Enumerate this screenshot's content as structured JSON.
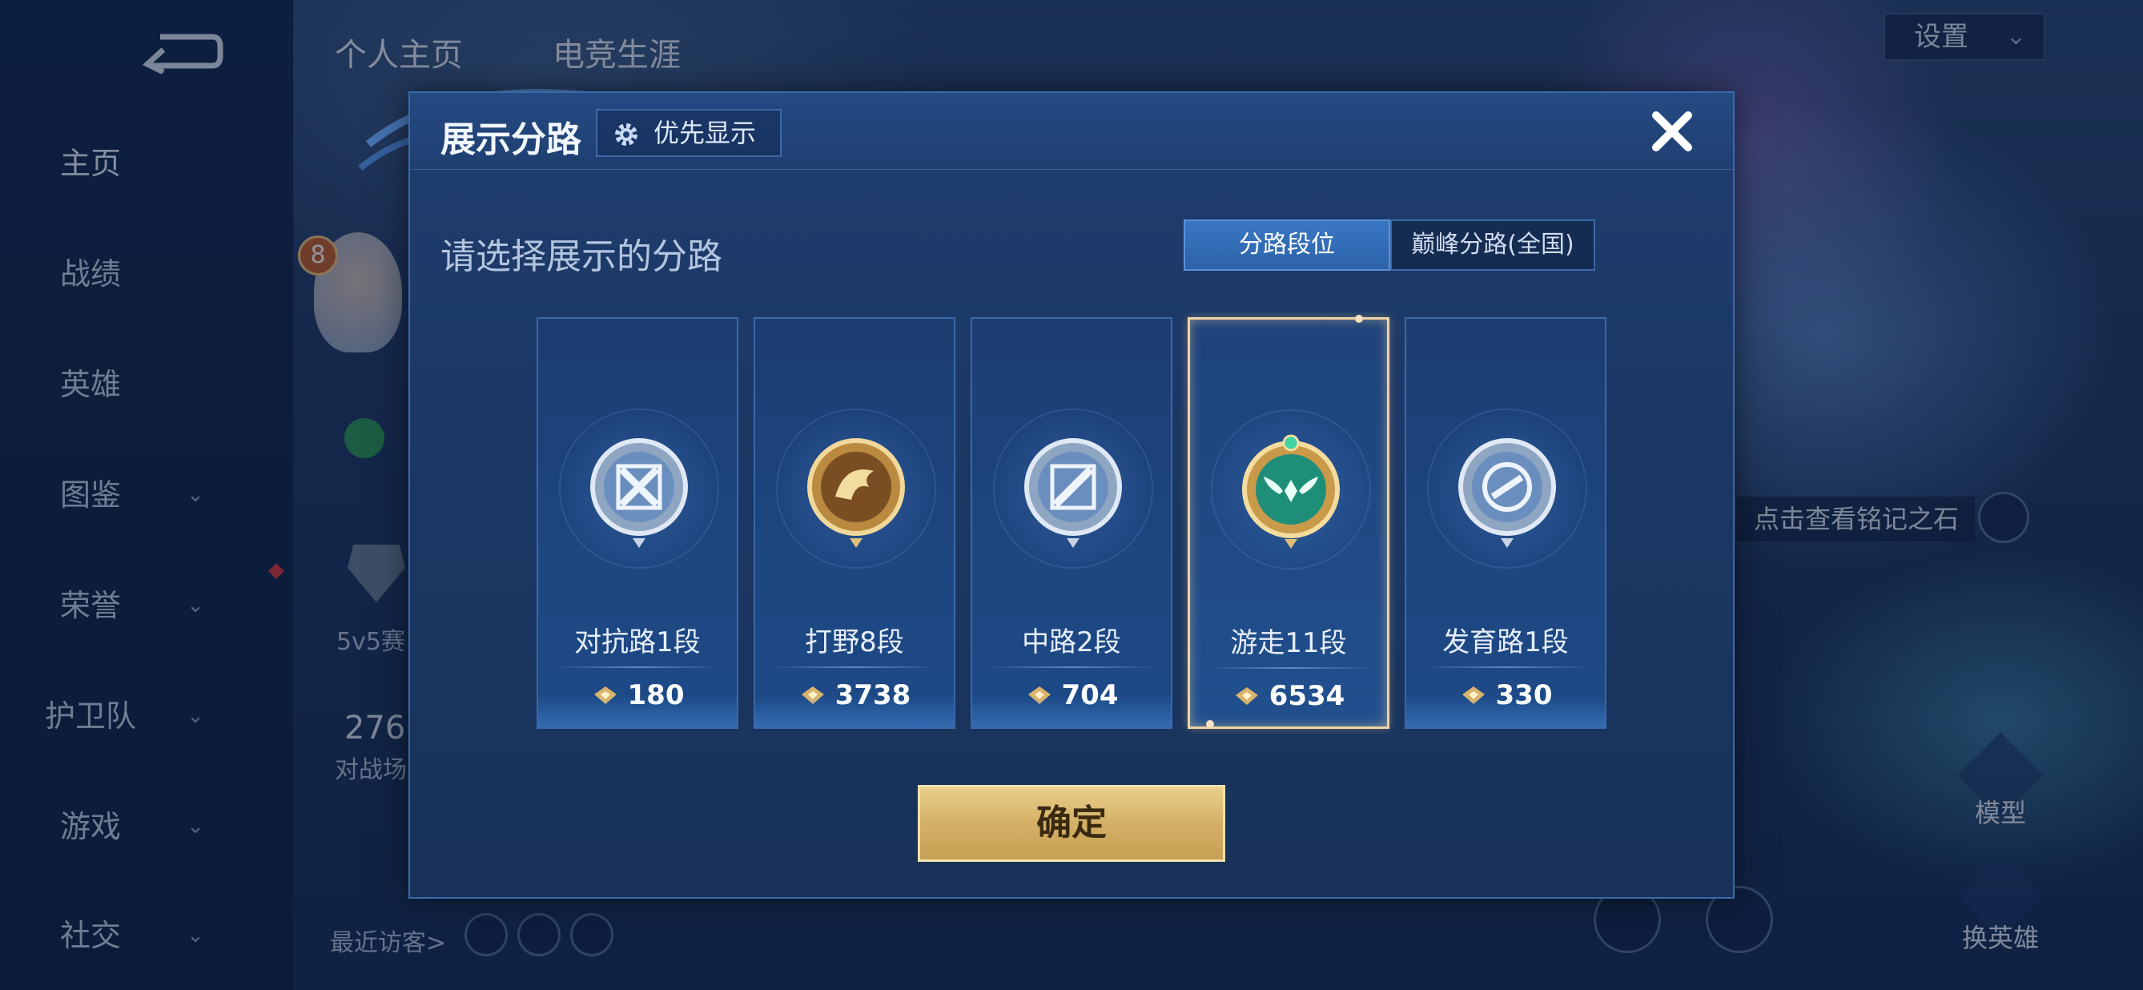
{
  "sidebar": {
    "items": [
      {
        "label": "主页",
        "chevron": false
      },
      {
        "label": "战绩",
        "chevron": false
      },
      {
        "label": "英雄",
        "chevron": false
      },
      {
        "label": "图鉴",
        "chevron": true
      },
      {
        "label": "荣誉",
        "chevron": true
      },
      {
        "label": "护卫队",
        "chevron": true
      },
      {
        "label": "游戏",
        "chevron": true
      },
      {
        "label": "社交",
        "chevron": true
      }
    ]
  },
  "top_tabs": [
    "个人主页",
    "电竞生涯"
  ],
  "settings": {
    "label": "设置"
  },
  "background": {
    "level": "8",
    "mode_text": "5v5赛",
    "count_text": "276",
    "count_label": "对战场",
    "visitors_label": "最近访客>",
    "stone_hint": "点击查看铭记之石",
    "model_label": "模型",
    "switch_hero_label": "换英雄"
  },
  "dialog": {
    "title": "展示分路",
    "priority_label": "优先显示",
    "subtitle": "请选择展示的分路",
    "segments": [
      "分路段位",
      "巅峰分路(全国)"
    ],
    "confirm_label": "确定",
    "lanes": [
      {
        "name": "对抗路1段",
        "score": "180",
        "selected": false,
        "badge": "silver-cross-badge-icon"
      },
      {
        "name": "打野8段",
        "score": "3738",
        "selected": false,
        "badge": "gold-dragon-badge-icon"
      },
      {
        "name": "中路2段",
        "score": "704",
        "selected": false,
        "badge": "silver-slash-badge-icon"
      },
      {
        "name": "游走11段",
        "score": "6534",
        "selected": true,
        "badge": "emerald-wing-badge-icon"
      },
      {
        "name": "发育路1段",
        "score": "330",
        "selected": false,
        "badge": "silver-s-badge-icon"
      }
    ]
  },
  "colors": {
    "accent_blue": "#2c62a8",
    "gold": "#d4b066",
    "selected_border": "#f0d3a2",
    "dialog_bg": "#1a3662"
  }
}
